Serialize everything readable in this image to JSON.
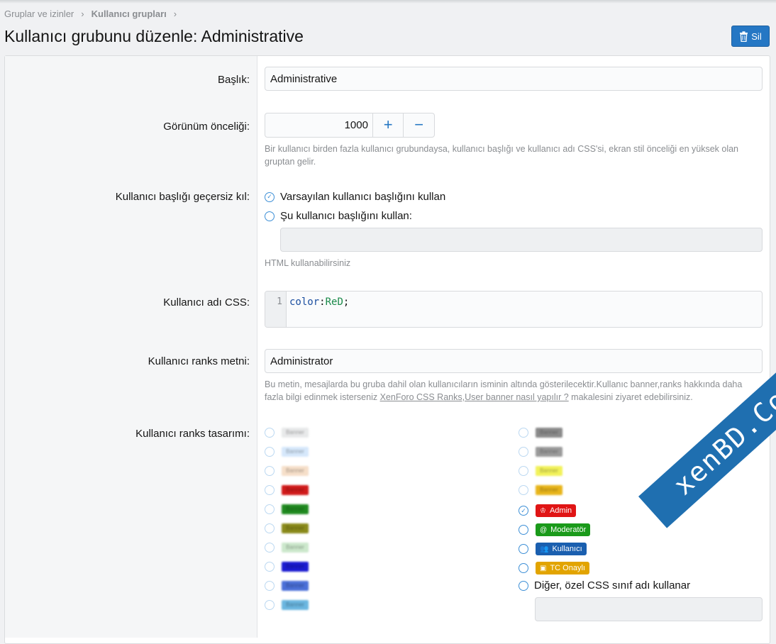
{
  "breadcrumb": {
    "items": [
      "Gruplar ve izinler",
      "Kullanıcı grupları"
    ],
    "sep": "›"
  },
  "page": {
    "title": "Kullanıcı grubunu düzenle: Administrative",
    "delete_label": "Sil"
  },
  "form": {
    "title_label": "Başlık:",
    "title_value": "Administrative",
    "priority_label": "Görünüm önceliği:",
    "priority_value": "1000",
    "plus": "+",
    "minus": "−",
    "priority_hint": "Bir kullanıcı birden fazla kullanıcı grubundaysa, kullanıcı başlığı ve kullanıcı adı CSS'si, ekran stil önceliği en yüksek olan gruptan gelir.",
    "override_label": "Kullanıcı başlığı geçersiz kıl:",
    "override_opt1": "Varsayılan kullanıcı başlığını kullan",
    "override_opt2": "Şu kullanıcı başlığını kullan:",
    "html_hint": "HTML kullanabilirsiniz",
    "css_label": "Kullanıcı adı CSS:",
    "css_line": "1",
    "css_prop": "color",
    "css_colon": ":",
    "css_val": "ReD",
    "css_semi": ";",
    "rank_text_label": "Kullanıcı ranks metni:",
    "rank_text_value": "Administrator",
    "rank_hint_a": "Bu metin, mesajlarda bu gruba dahil olan kullanıcıların isminin altında gösterilecektir.Kullanıc banner,ranks hakkında daha fazla bilgi edinmek isterseniz ",
    "rank_hint_link": "XenForo CSS Ranks,User banner nasıl yapılır ?",
    "rank_hint_b": " makalesini ziyaret edebilirsiniz.",
    "rank_design_label": "Kullanıcı ranks tasarımı:",
    "blur_text": "Banner",
    "badge_admin": "Admin",
    "badge_mod": "Moderatör",
    "badge_user": "Kullanıcı",
    "badge_tc": "TC Onaylı",
    "custom_label": "Diğer, özel CSS sınıf adı kullanar"
  },
  "colors": {
    "left_badges": [
      "#e8e9ea",
      "#d6e8fb",
      "#f6dfc9",
      "#d11a1a",
      "#1f8a1f",
      "#8a8a1a",
      "#cce8cc",
      "#1a1ad1",
      "#4a6fd8",
      "#6ab6e0"
    ],
    "right_badges": [
      "#8a8a8a",
      "#9a9a9a",
      "#f2f25a",
      "#e8b51a"
    ],
    "admin": "#e01515",
    "mod": "#1a9a1a",
    "user": "#1a5faf",
    "tc": "#e2a400"
  },
  "watermark": "xenBD.Com"
}
